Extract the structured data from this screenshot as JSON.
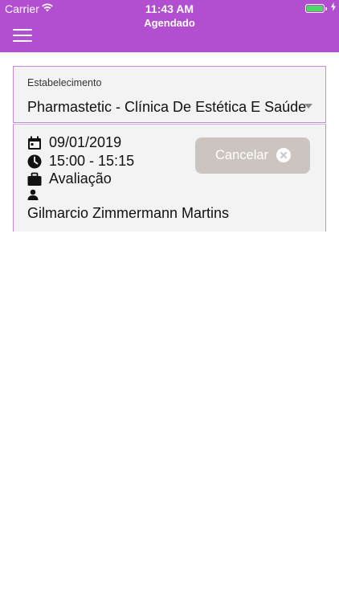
{
  "status": {
    "carrier": "Carrier",
    "time": "11:43 AM"
  },
  "header": {
    "title": "Agendado",
    "menu_icon": "hamburger-icon",
    "color": "#b24fd0"
  },
  "establishment": {
    "label": "Estabelecimento",
    "selected": "Pharmastetic - Clínica De Estética E Saúde"
  },
  "appointment": {
    "date": "09/01/2019",
    "time": "15:00 - 15:15",
    "service": "Avaliação",
    "professional": "Gilmarcio Zimmermann Martins",
    "cancel_label": "Cancelar",
    "icons": [
      "calendar-icon",
      "clock-icon",
      "briefcase-icon",
      "person-icon",
      "close-circle-icon"
    ]
  }
}
